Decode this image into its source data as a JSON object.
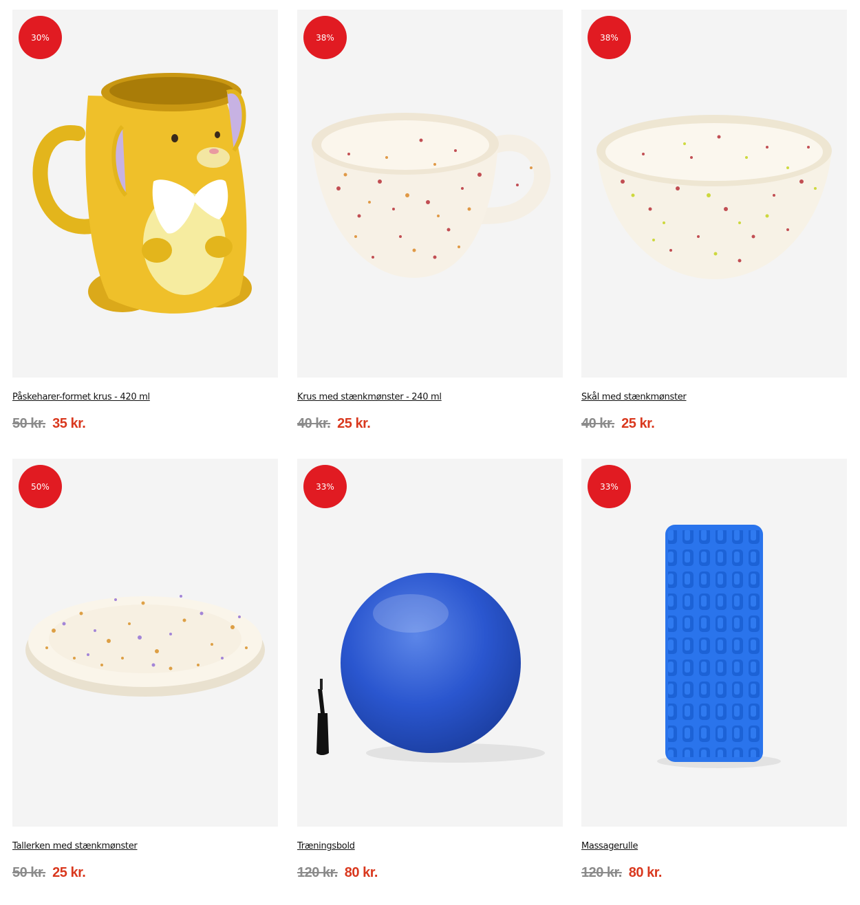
{
  "colors": {
    "badge": "#e11b22",
    "sale_price": "#d9381e",
    "old_price": "#8a8a8a",
    "image_bg": "#f4f4f4"
  },
  "products": [
    {
      "badge": "30%",
      "title": "Påskeharer-formet krus - 420 ml",
      "old_price": "50 kr.",
      "new_price": "35 kr.",
      "image": "bunny-mug-icon"
    },
    {
      "badge": "38%",
      "title": "Krus med stænkmønster - 240 ml",
      "old_price": "40 kr.",
      "new_price": "25 kr.",
      "image": "speckled-mug-icon"
    },
    {
      "badge": "38%",
      "title": "Skål med stænkmønster",
      "old_price": "40 kr.",
      "new_price": "25 kr.",
      "image": "speckled-bowl-icon"
    },
    {
      "badge": "50%",
      "title": "Tallerken med stænkmønster",
      "old_price": "50 kr.",
      "new_price": "25 kr.",
      "image": "speckled-plate-icon"
    },
    {
      "badge": "33%",
      "title": "Træningsbold",
      "old_price": "120 kr.",
      "new_price": "80 kr.",
      "image": "exercise-ball-icon"
    },
    {
      "badge": "33%",
      "title": "Massagerulle",
      "old_price": "120 kr.",
      "new_price": "80 kr.",
      "image": "foam-roller-icon"
    }
  ]
}
